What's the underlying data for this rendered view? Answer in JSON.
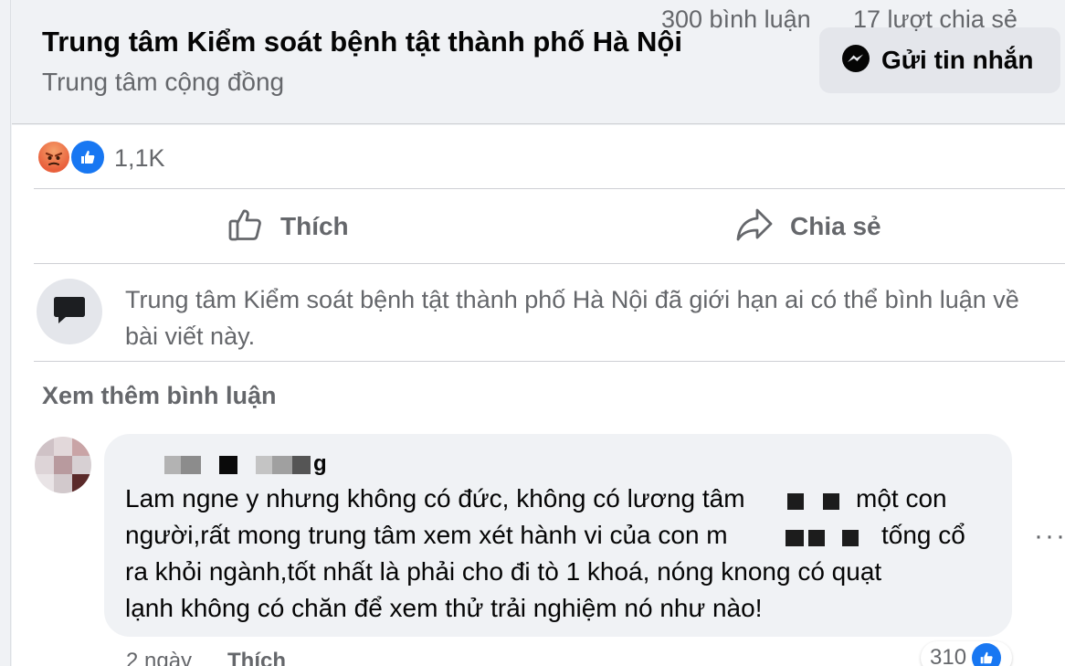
{
  "header": {
    "page_name": "Trung tâm Kiểm soát bệnh tật thành phố Hà Nội",
    "page_category": "Trung tâm cộng đồng",
    "message_button": "Gửi tin nhắn",
    "message_icon": "messenger-icon"
  },
  "post_stats": {
    "reaction_icons": [
      "angry-reaction-icon",
      "like-reaction-icon"
    ],
    "reaction_count": "1,1K",
    "comment_count": "300 bình luận",
    "share_count": "17 lượt chia sẻ"
  },
  "actions": {
    "like_label": "Thích",
    "share_label": "Chia sẻ"
  },
  "restriction_notice": "Trung tâm Kiểm soát bệnh tật thành phố Hà Nội đã giới hạn ai có thể bình luận về bài viết này.",
  "more_comments_label": "Xem thêm bình luận",
  "comment": {
    "author_visible_tail": "g",
    "text_line1": "Lam ngne y nhưng không có đức, không có lương tâm",
    "text_line1_end": "một con",
    "text_line2": "người,rất mong trung tâm xem xét hành vi của con m",
    "text_line2_end": "tống cổ",
    "text_line3": "ra khỏi ngành,tốt nhất là phải cho đi tò 1 khoá, nóng knong có quạt",
    "text_line4": "lạnh không có chăn để xem thử trải nghiệm nó như nào!",
    "time": "2 ngày",
    "like_label": "Thích",
    "reaction_count": "310",
    "more_options": "···"
  },
  "colors": {
    "accent_blue": "#1877f2",
    "secondary_text": "#65676b",
    "bubble_bg": "#f0f2f5",
    "button_bg": "#e4e6eb"
  }
}
